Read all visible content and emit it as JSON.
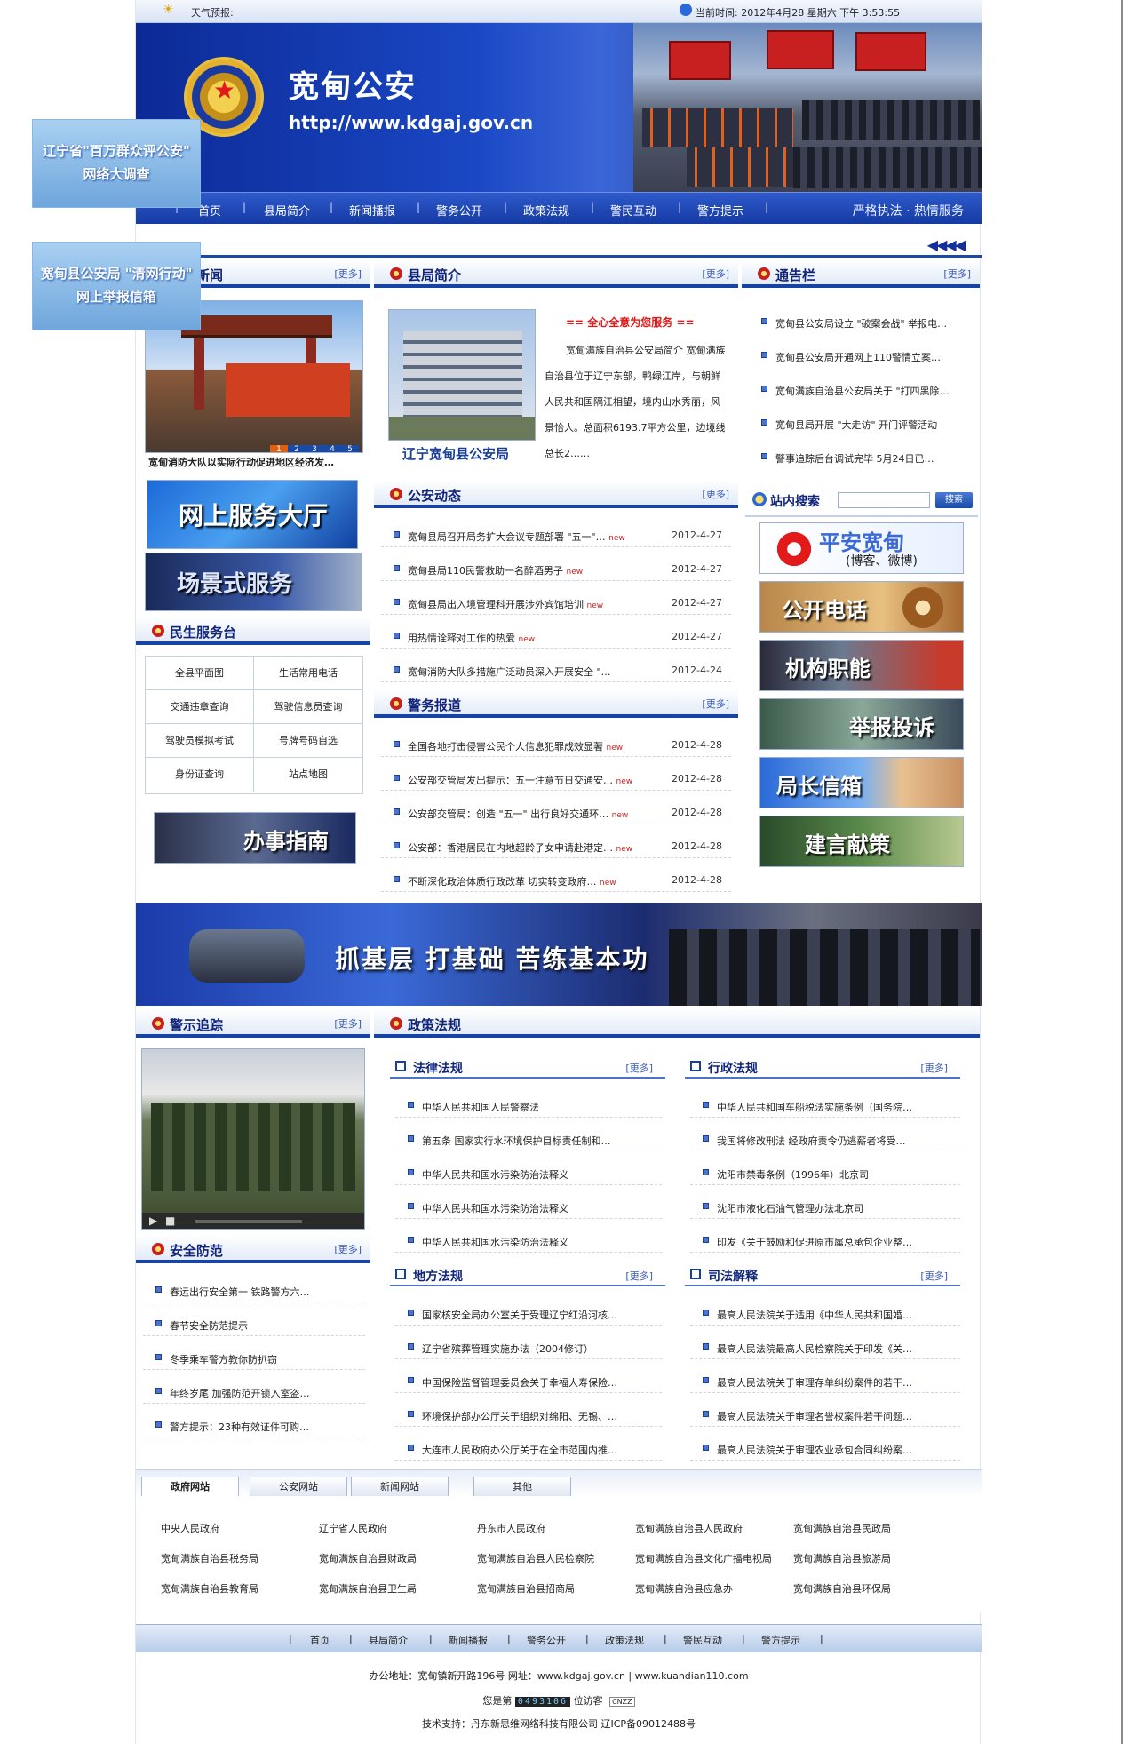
{
  "top": {
    "weather": "天气预报:",
    "datetime": "当前时间: 2012年4月28 星期六 下午 3:53:55"
  },
  "banner": {
    "name": "宽甸公安",
    "url": "http://www.kdgaj.gov.cn",
    "slogan": "严格执法 · 热情服务"
  },
  "nav": [
    "首页",
    "县局简介",
    "新闻播报",
    "警务公开",
    "政策法规",
    "警民互动",
    "警方提示"
  ],
  "float_ads": [
    "辽宁省\"百万群众评公安\"",
    "网络大调查",
    "宽甸县公安局 \"清网行动\"",
    "网上举报信箱"
  ],
  "more": "[更多]",
  "news": {
    "title": "图片新闻",
    "caption": "宽甸消防大队以实际行动促进地区经济发…",
    "pages": [
      "1",
      "2",
      "3",
      "4",
      "5"
    ]
  },
  "service_banners": [
    "网上服务大厅",
    "场景式服务"
  ],
  "minsheng": {
    "title": "民生服务台",
    "cells": [
      "全县平面图",
      "生活常用电话",
      "交通违章查询",
      "驾驶信息员查询",
      "驾驶员模拟考试",
      "号牌号码自选",
      "身份证查询",
      "站点地图"
    ]
  },
  "guide": "办事指南",
  "intro": {
    "title": "县局简介",
    "caption": "辽宁宽甸县公安局",
    "slogan": "== 全心全意为您服务 ==",
    "text": "宽甸满族自治县公安局简介  宽甸满族自治县位于辽宁东部，鸭绿江岸，与朝鲜人民共和国隔江相望，境内山水秀丽，风景怡人。总面积6193.7平方公里，边境线总长2……"
  },
  "notice": {
    "title": "通告栏",
    "items": [
      "宽甸县公安局设立 \"破案会战\" 举报电…",
      "宽甸县公安局开通网上110警情立案…",
      "宽甸满族自治县公安局关于 \"打四黑除…",
      "宽甸县局开展 \"大走访\" 开门评警活动",
      "警事追踪后台调试完毕 5月24日已…"
    ]
  },
  "search": {
    "title": "站内搜索",
    "button": "搜索",
    "placeholder": ""
  },
  "side_buttons": [
    "平安宽甸",
    "(博客、微博)",
    "公开电话",
    "机构职能",
    "举报投诉",
    "局长信箱",
    "建言献策"
  ],
  "dynamics": {
    "title": "公安动态",
    "items": [
      {
        "t": "宽甸县局召开局务扩大会议专题部署 \"五一\"…",
        "d": "2012-4-27"
      },
      {
        "t": "宽甸县局110民警救助一名醉酒男子",
        "d": "2012-4-27"
      },
      {
        "t": "宽甸县局出入境管理科开展涉外宾馆培训",
        "d": "2012-4-27"
      },
      {
        "t": "用热情诠释对工作的热爱",
        "d": "2012-4-27"
      },
      {
        "t": "宽甸消防大队多措施广泛动员深入开展安全 \"…",
        "d": "2012-4-24"
      }
    ]
  },
  "police_news": {
    "title": "警务报道",
    "items": [
      {
        "t": "全国各地打击侵害公民个人信息犯罪成效显著",
        "d": "2012-4-28"
      },
      {
        "t": "公安部交管局发出提示：五一注意节日交通安…",
        "d": "2012-4-28"
      },
      {
        "t": "公安部交管局：创造 \"五一\" 出行良好交通环…",
        "d": "2012-4-28"
      },
      {
        "t": "公安部：香港居民在内地超龄子女申请赴港定…",
        "d": "2012-4-28"
      },
      {
        "t": "不断深化政治体质行政改革 切实转变政府…",
        "d": "2012-4-28"
      }
    ]
  },
  "new_tag": "new",
  "mid_banner": "抓基层 打基础 苦练基本功",
  "tracking": {
    "title": "警示追踪"
  },
  "safety": {
    "title": "安全防范",
    "items": [
      "春运出行安全第一 铁路警方六…",
      "春节安全防范提示",
      "冬季乘车警方教你防扒窃",
      "年终岁尾 加强防范开锁入室盗…",
      "警方提示：23种有效证件可购…"
    ]
  },
  "policy": {
    "title": "政策法规",
    "law": {
      "title": "法律法规",
      "items": [
        "中华人民共和国人民警察法",
        "第五条 国家实行水环境保护目标责任制和…",
        "中华人民共和国水污染防治法释义",
        "中华人民共和国水污染防治法释义",
        "中华人民共和国水污染防治法释义"
      ]
    },
    "admin": {
      "title": "行政法规",
      "items": [
        "中华人民共和国车船税法实施条例（国务院…",
        "我国将修改刑法 经政府责令仍逃薪者将受…",
        "沈阳市禁毒条例（1996年）北京司",
        "沈阳市液化石油气管理办法北京司",
        "印发《关于鼓励和促进原市属总承包企业整…"
      ]
    },
    "local": {
      "title": "地方法规",
      "items": [
        "国家核安全局办公室关于受理辽宁红沿河核…",
        "辽宁省殡葬管理实施办法（2004修订）",
        "中国保险监督管理委员会关于幸福人寿保险…",
        "环境保护部办公厅关于组织对绵阳、无锡、…",
        "大连市人民政府办公厅关于在全市范围内推…"
      ]
    },
    "judicial": {
      "title": "司法解释",
      "items": [
        "最高人民法院关于适用《中华人民共和国婚…",
        "最高人民法院最高人民检察院关于印发《关…",
        "最高人民法院关于审理存单纠纷案件的若干…",
        "最高人民法院关于审理名誉权案件若干问题…",
        "最高人民法院关于审理农业承包合同纠纷案…"
      ]
    }
  },
  "link_tabs": [
    "政府网站",
    "公安网站",
    "新闻网站",
    "其他"
  ],
  "links": [
    "中央人民政府",
    "辽宁省人民政府",
    "丹东市人民政府",
    "宽甸满族自治县人民政府",
    "宽甸满族自治县民政局",
    "宽甸满族自治县税务局",
    "宽甸满族自治县财政局",
    "宽甸满族自治县人民检察院",
    "宽甸满族自治县文化广播电视局",
    "宽甸满族自治县旅游局",
    "宽甸满族自治县教育局",
    "宽甸满族自治县卫生局",
    "宽甸满族自治县招商局",
    "宽甸满族自治县应急办",
    "宽甸满族自治县环保局"
  ],
  "footer": {
    "address": "办公地址：宽甸镇新开路196号 网址：www.kdgaj.gov.cn | www.kuandian110.com",
    "visitor_pre": "您是第",
    "visitor_count": "0493106",
    "visitor_post": "位访客",
    "cnzz": "CNZZ",
    "support": "技术支持：丹东新思维网络科技有限公司 辽ICP备09012488号"
  }
}
